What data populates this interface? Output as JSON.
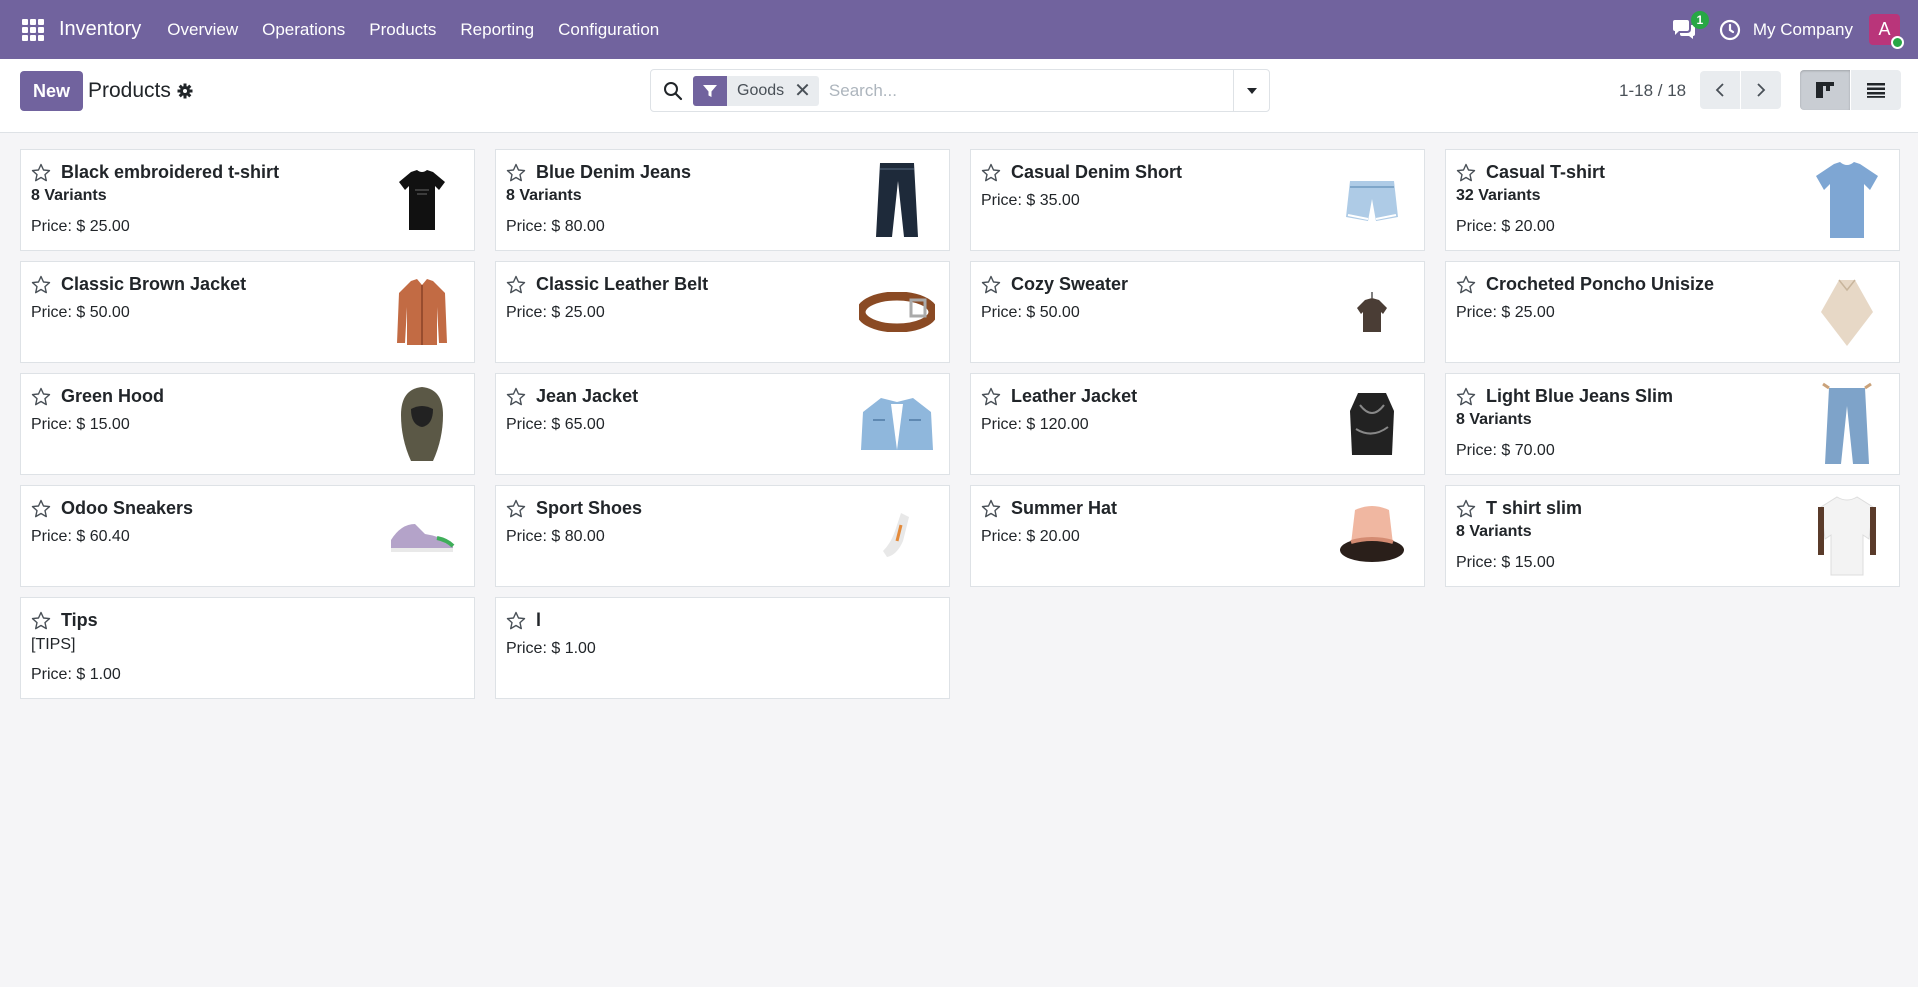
{
  "navbar": {
    "app_name": "Inventory",
    "menu": [
      "Overview",
      "Operations",
      "Products",
      "Reporting",
      "Configuration"
    ],
    "chat_count": "1",
    "company": "My Company",
    "avatar_initial": "A",
    "color": "#71639e"
  },
  "control_panel": {
    "new_label": "New",
    "title": "Products",
    "facet_label": "Goods",
    "search_placeholder": "Search...",
    "pager_value": "1-18 / 18"
  },
  "products": [
    {
      "name": "Black embroidered t-shirt",
      "variants": "8 Variants",
      "ref": "",
      "price": "Price: $ 25.00",
      "image": "black-tshirt"
    },
    {
      "name": "Blue Denim Jeans",
      "variants": "8 Variants",
      "ref": "",
      "price": "Price: $ 80.00",
      "image": "dark-jeans"
    },
    {
      "name": "Casual Denim Short",
      "variants": "",
      "ref": "",
      "price": "Price: $ 35.00",
      "image": "denim-short"
    },
    {
      "name": "Casual T-shirt",
      "variants": "32 Variants",
      "ref": "",
      "price": "Price: $ 20.00",
      "image": "blue-tshirt"
    },
    {
      "name": "Classic Brown Jacket",
      "variants": "",
      "ref": "",
      "price": "Price: $ 50.00",
      "image": "brown-jacket"
    },
    {
      "name": "Classic Leather Belt",
      "variants": "",
      "ref": "",
      "price": "Price: $ 25.00",
      "image": "leather-belt"
    },
    {
      "name": "Cozy Sweater",
      "variants": "",
      "ref": "",
      "price": "Price: $ 50.00",
      "image": "sweater"
    },
    {
      "name": "Crocheted Poncho Unisize",
      "variants": "",
      "ref": "",
      "price": "Price: $ 25.00",
      "image": "poncho"
    },
    {
      "name": "Green Hood",
      "variants": "",
      "ref": "",
      "price": "Price: $ 15.00",
      "image": "green-hood"
    },
    {
      "name": "Jean Jacket",
      "variants": "",
      "ref": "",
      "price": "Price: $ 65.00",
      "image": "jean-jacket"
    },
    {
      "name": "Leather Jacket",
      "variants": "",
      "ref": "",
      "price": "Price: $ 120.00",
      "image": "leather-jacket"
    },
    {
      "name": "Light Blue Jeans Slim",
      "variants": "8 Variants",
      "ref": "",
      "price": "Price: $ 70.00",
      "image": "light-jeans"
    },
    {
      "name": "Odoo Sneakers",
      "variants": "",
      "ref": "",
      "price": "Price: $ 60.40",
      "image": "sneakers"
    },
    {
      "name": "Sport Shoes",
      "variants": "",
      "ref": "",
      "price": "Price: $ 80.00",
      "image": "sport-shoe"
    },
    {
      "name": "Summer Hat",
      "variants": "",
      "ref": "",
      "price": "Price: $ 20.00",
      "image": "summer-hat"
    },
    {
      "name": "T shirt slim",
      "variants": "8 Variants",
      "ref": "",
      "price": "Price: $ 15.00",
      "image": "white-tshirt"
    },
    {
      "name": "Tips",
      "variants": "",
      "ref": "[TIPS]",
      "price": "Price: $ 1.00",
      "image": ""
    },
    {
      "name": "l",
      "variants": "",
      "ref": "",
      "price": "Price: $ 1.00",
      "image": ""
    }
  ]
}
